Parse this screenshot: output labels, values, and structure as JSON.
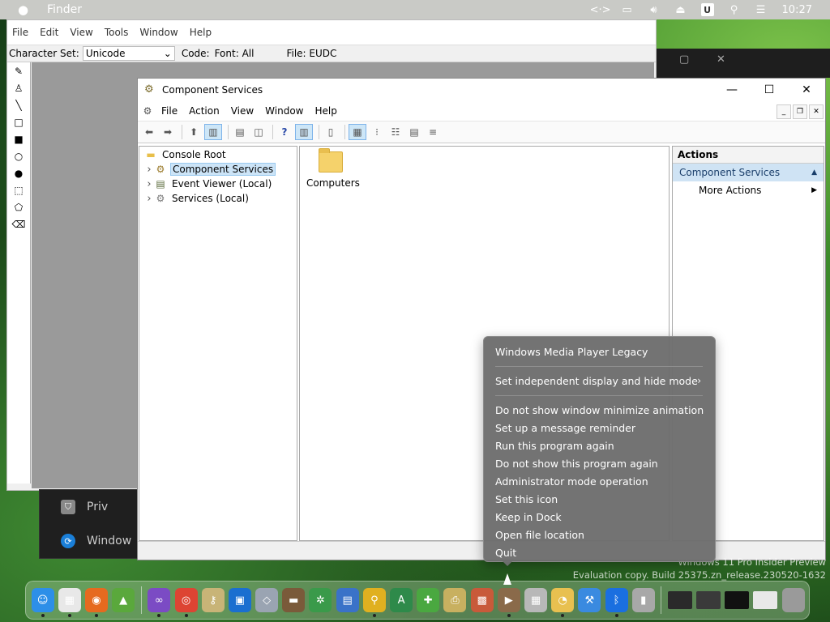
{
  "menubar": {
    "app_name": "Finder",
    "clock": "10:27",
    "status_icons": [
      "code-icon",
      "display-icon",
      "volume-icon",
      "eject-icon",
      "u-app-icon",
      "search-icon",
      "control-center-icon"
    ],
    "u_label": "U"
  },
  "eudc": {
    "menu": [
      "File",
      "Edit",
      "View",
      "Tools",
      "Window",
      "Help"
    ],
    "charset_label": "Character Set:",
    "charset_value": "Unicode",
    "code_label": "Code:",
    "font_label": "Font: All",
    "file_label": "File: EUDC",
    "tools": [
      "pencil-icon",
      "brush-icon",
      "line-icon",
      "hollow-rectangle-icon",
      "filled-rectangle-icon",
      "hollow-ellipse-icon",
      "filled-ellipse-icon",
      "rect-select-icon",
      "freeform-select-icon",
      "eraser-icon"
    ]
  },
  "background_popup": {
    "items": [
      {
        "label": "Priv",
        "icon": "shield-icon"
      },
      {
        "label": "Window",
        "icon": "update-icon"
      }
    ]
  },
  "component_services": {
    "title": "Component Services",
    "menu": [
      "File",
      "Action",
      "View",
      "Window",
      "Help"
    ],
    "tree": [
      {
        "label": "Console Root",
        "icon": "folder-icon",
        "expandable": false,
        "selected": false
      },
      {
        "label": "Component Services",
        "icon": "component-services-icon",
        "expandable": true,
        "selected": true
      },
      {
        "label": "Event Viewer (Local)",
        "icon": "event-viewer-icon",
        "expandable": true,
        "selected": false
      },
      {
        "label": "Services (Local)",
        "icon": "services-icon",
        "expandable": true,
        "selected": false
      }
    ],
    "main_items": [
      {
        "label": "Computers",
        "icon": "folder-icon"
      }
    ],
    "actions": {
      "header": "Actions",
      "section": "Component Services",
      "items": [
        {
          "label": "More Actions"
        }
      ]
    }
  },
  "context_menu": {
    "items": [
      {
        "label": "Windows Media Player Legacy",
        "type": "item"
      },
      {
        "type": "separator"
      },
      {
        "label": "Set independent display and hide mode",
        "type": "submenu"
      },
      {
        "type": "separator"
      },
      {
        "label": "Do not show window minimize animation",
        "type": "item"
      },
      {
        "label": "Set up a message reminder",
        "type": "item"
      },
      {
        "label": "Run this program again",
        "type": "item"
      },
      {
        "label": "Do not show this program again",
        "type": "item"
      },
      {
        "label": "Administrator mode operation",
        "type": "item"
      },
      {
        "label": "Set this icon",
        "type": "item"
      },
      {
        "label": "Keep in Dock",
        "type": "item"
      },
      {
        "label": "Open file location",
        "type": "item"
      },
      {
        "label": "Quit",
        "type": "item"
      }
    ]
  },
  "watermark": {
    "line1": "Windows 11 Pro Insider Preview",
    "line2": "Evaluation copy. Build 25375.zn_release.230520-1632"
  },
  "dock": {
    "apps": [
      {
        "name": "finder-icon",
        "color": "#2d8fe8",
        "glyph": "☺"
      },
      {
        "name": "launchpad-icon",
        "color": "#e8e8e8",
        "glyph": "▦"
      },
      {
        "name": "firefox-icon",
        "color": "#e66a1f",
        "glyph": "◉"
      },
      {
        "name": "image-editor-icon",
        "color": "#5aa83c",
        "glyph": "▲"
      },
      {
        "name": "visual-studio-icon",
        "color": "#7b4bc4",
        "glyph": "∞"
      },
      {
        "name": "chrome-icon",
        "color": "#dd4433",
        "glyph": "◎"
      },
      {
        "name": "keychain-icon",
        "color": "#c8b477",
        "glyph": "⚷"
      },
      {
        "name": "app-blue-icon",
        "color": "#1a6fd0",
        "glyph": "▣"
      },
      {
        "name": "archive-icon",
        "color": "#9aa4b2",
        "glyph": "◇"
      },
      {
        "name": "scanner-icon",
        "color": "#7a5a3a",
        "glyph": "▬"
      },
      {
        "name": "network-tool-icon",
        "color": "#3a9a4a",
        "glyph": "✲"
      },
      {
        "name": "control-panel-icon",
        "color": "#3a72c8",
        "glyph": "▤"
      },
      {
        "name": "search-magnifier-icon",
        "color": "#e0b020",
        "glyph": "⚲"
      },
      {
        "name": "font-app-icon",
        "color": "#2e8a4a",
        "glyph": "A"
      },
      {
        "name": "add-program-icon",
        "color": "#4aa840",
        "glyph": "✚"
      },
      {
        "name": "printer-icon",
        "color": "#c8b060",
        "glyph": "⎙"
      },
      {
        "name": "component-box-icon",
        "color": "#c85a3a",
        "glyph": "▩"
      },
      {
        "name": "media-player-icon",
        "color": "#8a6a4a",
        "glyph": "▶"
      },
      {
        "name": "calculator-icon",
        "color": "#b8b8b8",
        "glyph": "▦"
      },
      {
        "name": "folder-clock-icon",
        "color": "#e8c050",
        "glyph": "◔"
      },
      {
        "name": "xcode-icon",
        "color": "#3a8ae0",
        "glyph": "⚒"
      },
      {
        "name": "bluetooth-icon",
        "color": "#1a6fe0",
        "glyph": "ᛒ"
      },
      {
        "name": "drive-icon",
        "color": "#a8a8a8",
        "glyph": "▮"
      }
    ],
    "minimized": [
      {
        "name": "minimized-window-1-icon",
        "color": "#2a2a2a"
      },
      {
        "name": "minimized-window-2-icon",
        "color": "#3a3a3a"
      },
      {
        "name": "minimized-window-3-icon",
        "color": "#111111"
      },
      {
        "name": "minimized-window-4-icon",
        "color": "#e8e8e8"
      },
      {
        "name": "trash-icon",
        "color": "#9a9a9a"
      }
    ]
  }
}
